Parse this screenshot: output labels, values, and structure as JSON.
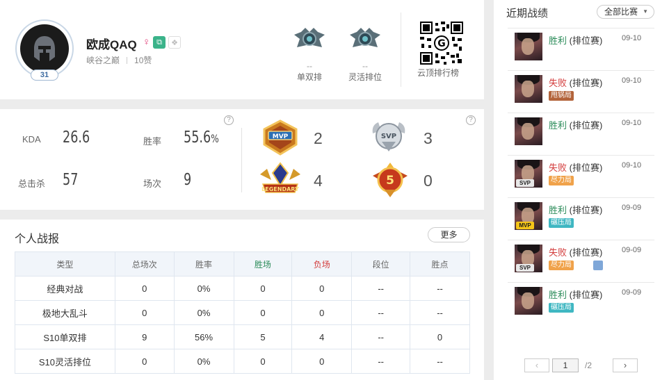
{
  "profile": {
    "name": "欧成QAQ",
    "gender_symbol": "♀",
    "region": "峡谷之巅",
    "likes": "10赞",
    "level": "31"
  },
  "ranks": [
    {
      "value": "--",
      "label": "单双排"
    },
    {
      "value": "--",
      "label": "灵活排位"
    }
  ],
  "qr": {
    "label": "云顶排行榜"
  },
  "stats": {
    "kda_label": "KDA",
    "kda": "26.6",
    "winrate_label": "胜率",
    "winrate": "55.6",
    "winrate_unit": "%",
    "kills_label": "总击杀",
    "kills": "57",
    "games_label": "场次",
    "games": "9",
    "help": "?"
  },
  "badges": [
    {
      "name": "MVP",
      "count": "2"
    },
    {
      "name": "SVP",
      "count": "3"
    },
    {
      "name": "LEGENDARY",
      "count": "4"
    },
    {
      "name": "5",
      "count": "0"
    }
  ],
  "report": {
    "title": "个人战报",
    "more": "更多",
    "headers": [
      "类型",
      "总场次",
      "胜率",
      "胜场",
      "负场",
      "段位",
      "胜点"
    ],
    "rows": [
      [
        "经典对战",
        "0",
        "0%",
        "0",
        "0",
        "--",
        "--"
      ],
      [
        "极地大乱斗",
        "0",
        "0%",
        "0",
        "0",
        "--",
        "--"
      ],
      [
        "S10单双排",
        "9",
        "56%",
        "5",
        "4",
        "--",
        "0"
      ],
      [
        "S10灵活排位",
        "0",
        "0%",
        "0",
        "0",
        "--",
        "--"
      ]
    ]
  },
  "recent": {
    "title": "近期战绩",
    "filter": "全部比赛",
    "matches": [
      {
        "result": "胜利",
        "outcome": "win",
        "mode": "(排位赛)",
        "date": "09-10",
        "tag": "",
        "badge": ""
      },
      {
        "result": "失败",
        "outcome": "lose",
        "mode": "(排位赛)",
        "date": "09-10",
        "tag": "甩锅局",
        "badge": ""
      },
      {
        "result": "胜利",
        "outcome": "win",
        "mode": "(排位赛)",
        "date": "09-10",
        "tag": "",
        "badge": ""
      },
      {
        "result": "失败",
        "outcome": "lose",
        "mode": "(排位赛)",
        "date": "09-10",
        "tag": "尽力局",
        "badge": "SVP"
      },
      {
        "result": "胜利",
        "outcome": "win",
        "mode": "(排位赛)",
        "date": "09-09",
        "tag": "碾压局",
        "badge": "MVP"
      },
      {
        "result": "失败",
        "outcome": "lose",
        "mode": "(排位赛)",
        "date": "09-09",
        "tag": "尽力局",
        "badge": "SVP"
      },
      {
        "result": "胜利",
        "outcome": "win",
        "mode": "(排位赛)",
        "date": "09-09",
        "tag": "碾压局",
        "badge": ""
      }
    ],
    "pager": {
      "prev": "‹",
      "current": "1",
      "total": "/2",
      "next": "›"
    }
  },
  "colors": {
    "win": "#2c8c5a",
    "lose": "#d33c3c"
  }
}
